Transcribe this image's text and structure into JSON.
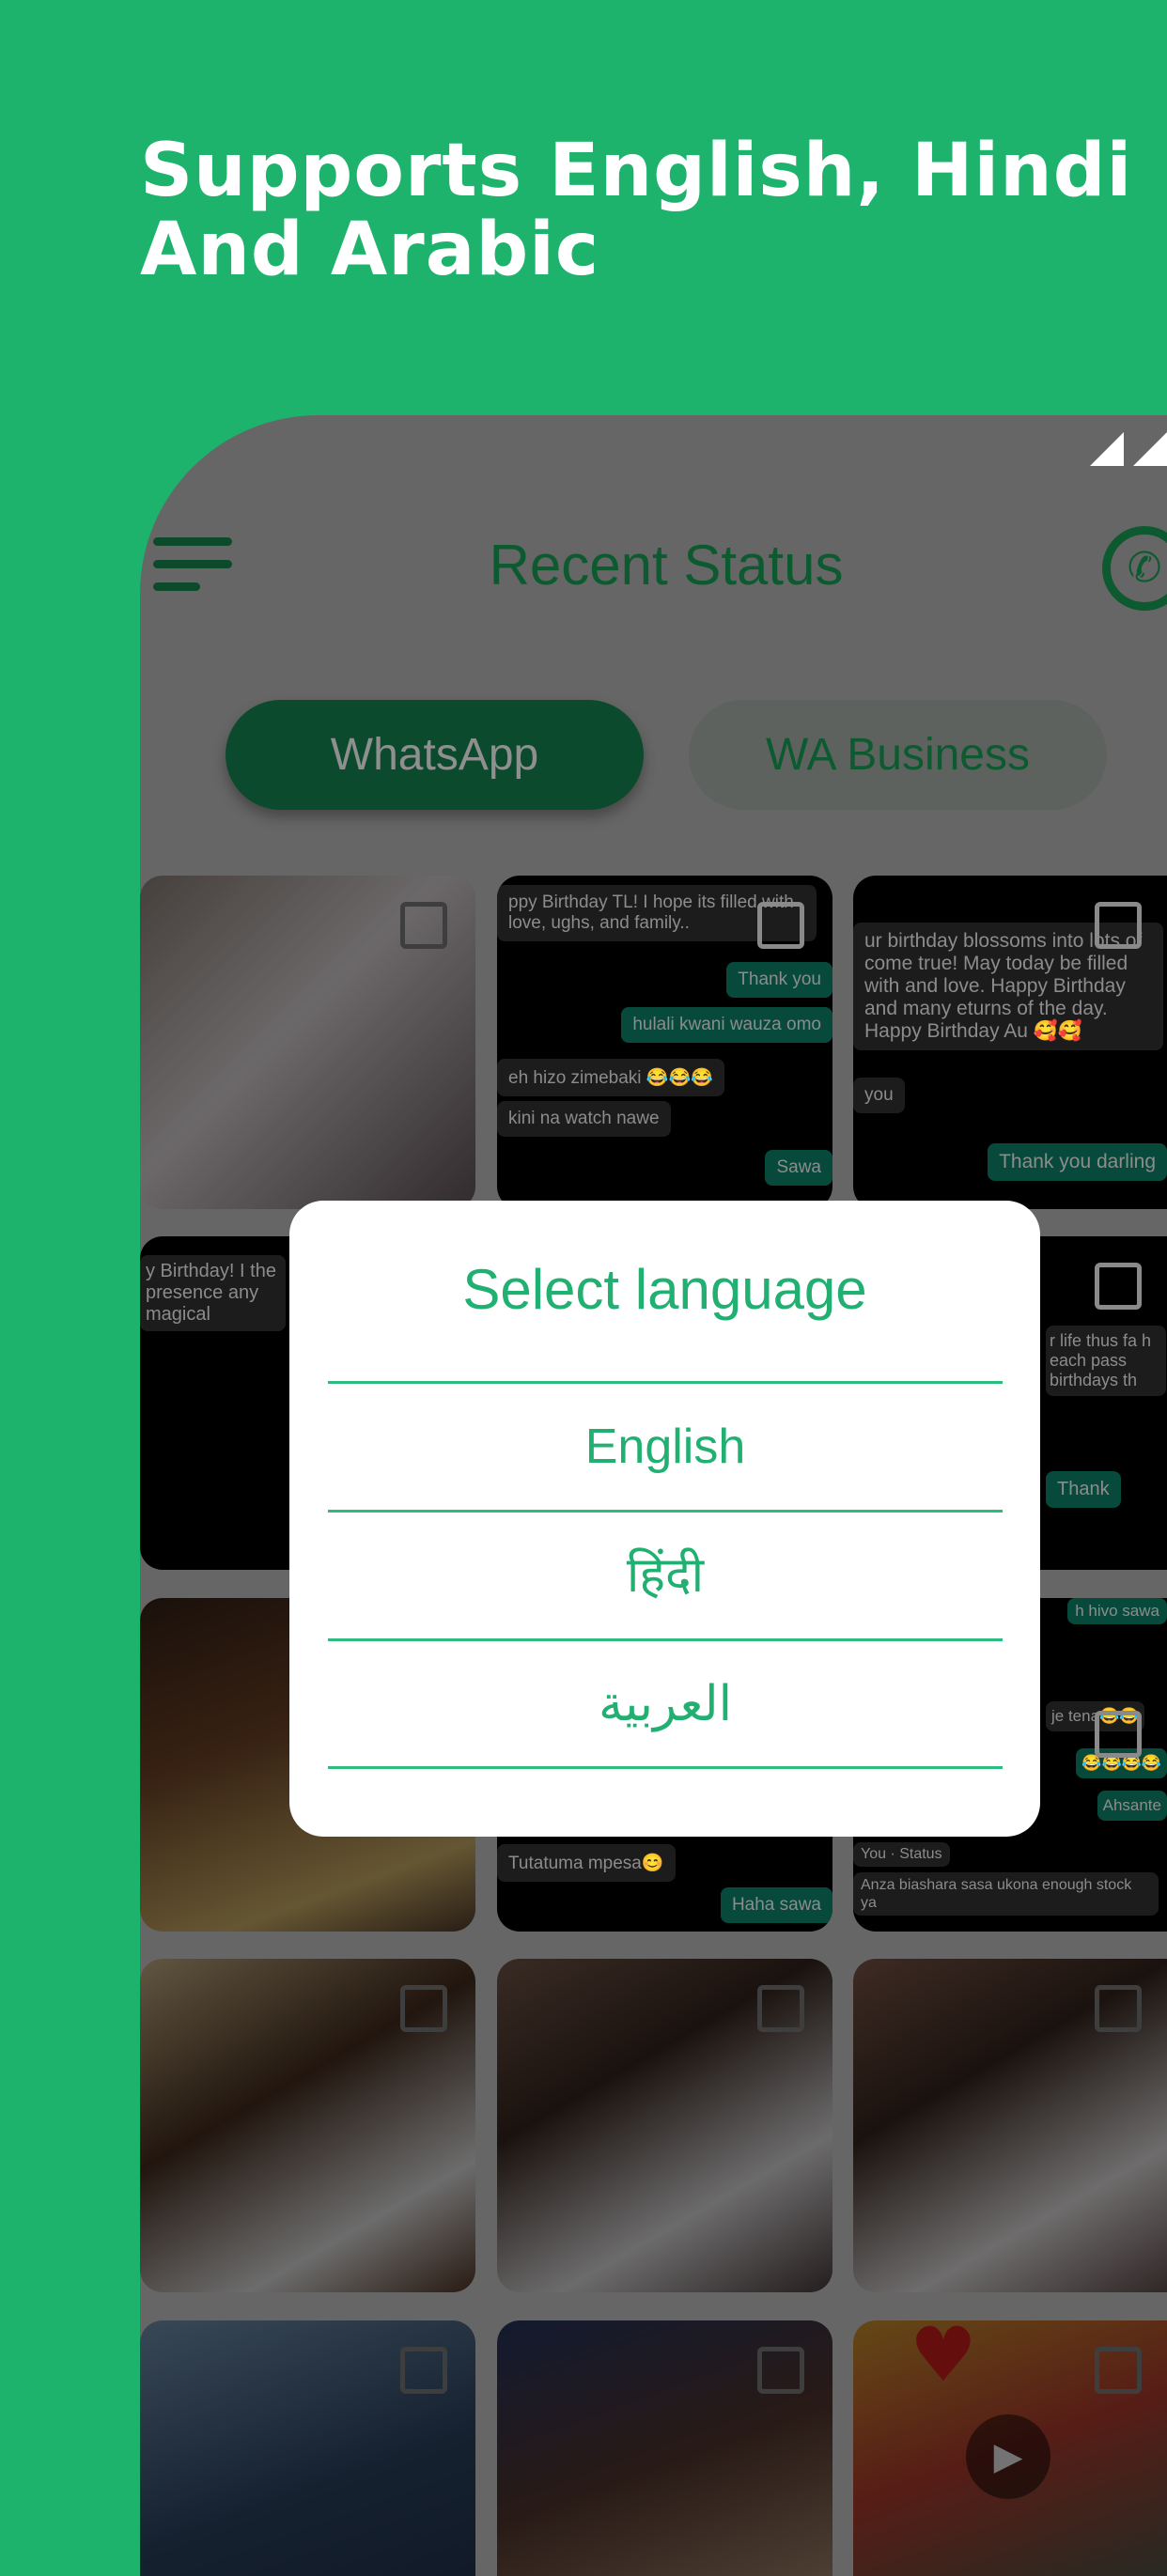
{
  "promo": {
    "line1": "Supports English, Hindi",
    "line2": "And Arabic"
  },
  "app": {
    "title": "Recent Status",
    "tabs": [
      {
        "label": "WhatsApp",
        "active": true
      },
      {
        "label": "WA Business",
        "active": false
      }
    ],
    "menu_icon": "hamburger-icon",
    "whatsapp_icon": "whatsapp-icon"
  },
  "tiles": {
    "t2": [
      "ppy Birthday TL! I hope its filled with love, ughs, and family..",
      "Thank you",
      "hulali kwani wauza omo",
      "eh hizo zimebaki 😂😂😂",
      "kini na watch nawe",
      "Sawa"
    ],
    "t3": [
      "ur birthday blossoms into lots of come true! May today be filled with and love. Happy Birthday and many eturns of the day. Happy Birthday Au 🥰🥰",
      "you",
      "Thank you darling"
    ],
    "t4": [
      "y Birthday! I the presence any magical"
    ],
    "t6": [
      "r life thus fa h each pass birthdays th",
      "Thank"
    ],
    "t8": [
      "Tutatuma mpesa😊",
      "Haha sawa"
    ],
    "t9": [
      "h hivo sawa",
      "je tena😂😂",
      "😂😂😂😂",
      "Ahsante",
      "You · Status",
      "Anza biashara sasa ukona enough stock ya"
    ]
  },
  "colors": {
    "brand": "#1db36c",
    "accent": "#22b072",
    "dim": "rgba(0,0,0,0.6)"
  },
  "dialog": {
    "title": "Select language",
    "options": [
      "English",
      "हिंदी",
      "العربية"
    ]
  }
}
